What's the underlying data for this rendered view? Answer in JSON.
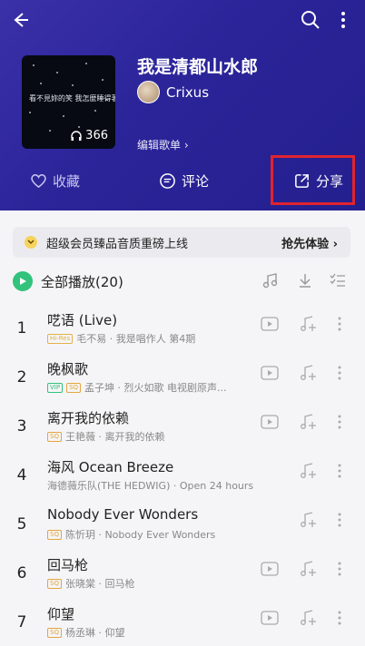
{
  "header": {
    "playlist_title": "我是清都山水郎",
    "username": "Crixus",
    "edit_label": "编辑歌单",
    "cover_text": "看不見妳的笑 我怎麼睡得著",
    "play_count": "366",
    "actions": {
      "favorite": "收藏",
      "comment": "评论",
      "share": "分享"
    }
  },
  "vip_banner": {
    "text": "超级会员臻品音质重磅上线",
    "cta": "抢先体验"
  },
  "playall": {
    "label": "全部播放(20)"
  },
  "songs": [
    {
      "num": "1",
      "title": "呓语 (Live)",
      "badges": [
        "Hi-Res"
      ],
      "meta": "毛不易 · 我是唱作人 第4期",
      "video": true
    },
    {
      "num": "2",
      "title": "晚枫歌",
      "badges": [
        "VIP",
        "SQ"
      ],
      "meta": "孟子坤 · 烈火如歌 电视剧原声...",
      "video": true
    },
    {
      "num": "3",
      "title": "离开我的依赖",
      "badges": [
        "SQ"
      ],
      "meta": "王艳薇 · 离开我的依赖",
      "video": true
    },
    {
      "num": "4",
      "title": "海风 Ocean Breeze",
      "badges": [],
      "meta": "海德薇乐队(THE HEDWIG) · Open 24 hours",
      "video": false
    },
    {
      "num": "5",
      "title": "Nobody Ever Wonders",
      "badges": [
        "SQ"
      ],
      "meta": "陈忻玥 · Nobody Ever Wonders",
      "video": false
    },
    {
      "num": "6",
      "title": "回马枪",
      "badges": [
        "SQ"
      ],
      "meta": "张晓棠 · 回马枪",
      "video": true
    },
    {
      "num": "7",
      "title": "仰望",
      "badges": [
        "SQ"
      ],
      "meta": "杨丞琳 · 仰望",
      "video": true
    }
  ],
  "colors": {
    "header_bg": "#2b2499",
    "accent_green": "#31c27c",
    "highlight_red": "#e0242f"
  }
}
